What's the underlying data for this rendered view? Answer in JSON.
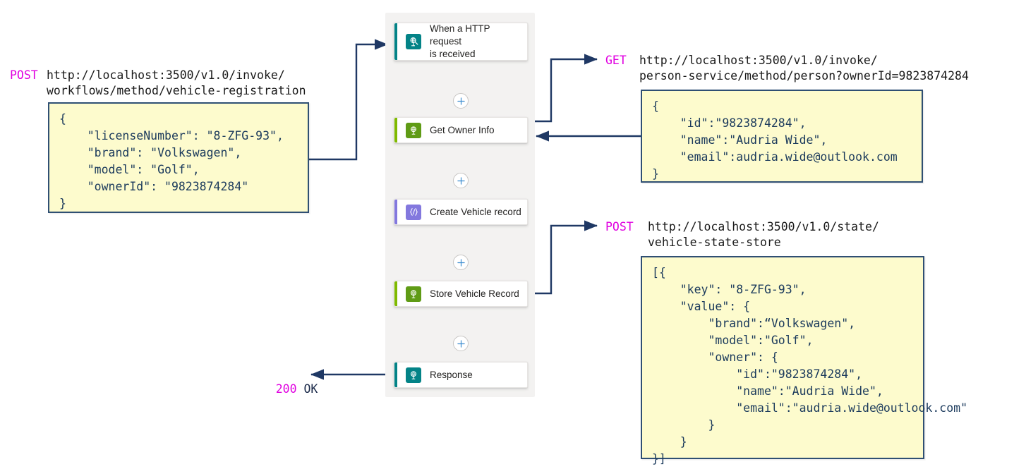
{
  "colors": {
    "trigger_accent": "#038387",
    "trigger_icon_bg": "#038387",
    "action_accent": "#7fba00",
    "action_icon_bg": "#5f9b15",
    "code_accent": "#8378de",
    "code_icon_bg": "#8378de",
    "wire": "#1f3864",
    "verb": "#e000e0",
    "json_fill": "#fdfbcd",
    "json_border": "#2f4f73",
    "container_bg": "#f3f2f1"
  },
  "workflow": {
    "nodes": [
      {
        "id": "http-trigger",
        "label": "When a HTTP request\nis received",
        "icon": "request-trigger-icon",
        "accent": "#038387",
        "icon_bg": "#038387",
        "type": "trigger"
      },
      {
        "id": "get-owner-info",
        "label": "Get Owner Info",
        "icon": "dapr-invoke-icon",
        "accent": "#7fba00",
        "icon_bg": "#5f9b15",
        "type": "action"
      },
      {
        "id": "create-vehicle-record",
        "label": "Create Vehicle record",
        "icon": "code-braces-icon",
        "accent": "#8378de",
        "icon_bg": "#8378de",
        "type": "code"
      },
      {
        "id": "store-vehicle-record",
        "label": "Store Vehicle Record",
        "icon": "dapr-state-icon",
        "accent": "#7fba00",
        "icon_bg": "#5f9b15",
        "type": "action"
      },
      {
        "id": "response",
        "label": "Response",
        "icon": "response-icon",
        "accent": "#038387",
        "icon_bg": "#038387",
        "type": "trigger"
      }
    ],
    "add_step_buttons": [
      {
        "id": "add-step-1",
        "label": "+"
      },
      {
        "id": "add-step-2",
        "label": "+"
      },
      {
        "id": "add-step-3",
        "label": "+"
      },
      {
        "id": "add-step-4",
        "label": "+"
      }
    ]
  },
  "request_in": {
    "verb": "POST",
    "url_line1": "http://localhost:3500/v1.0/invoke/",
    "url_line2": "workflows/method/vehicle-registration",
    "body": "{\n    \"licenseNumber\": \"8-ZFG-93\",\n    \"brand\": \"Volkswagen\",\n    \"model\": \"Golf\",\n    \"ownerId\": \"9823874284\"\n}"
  },
  "person_service_call": {
    "verb": "GET",
    "url_line1": "http://localhost:3500/v1.0/invoke/",
    "url_line2": "person-service/method/person?ownerId=9823874284",
    "body": "{\n    \"id\":\"9823874284\",\n    \"name\":\"Audria Wide\",\n    \"email\":audria.wide@outlook.com\n}"
  },
  "state_store_call": {
    "verb": "POST",
    "url_line1": "http://localhost:3500/v1.0/state/",
    "url_line2": "vehicle-state-store",
    "body": "[{\n    \"key\": \"8-ZFG-93\",\n    \"value\": {\n        \"brand\":“Volkswagen\",\n        \"model\":\"Golf\",\n        \"owner\": {\n            \"id\":\"9823874284\",\n            \"name\":\"Audria Wide\",\n            \"email\":\"audria.wide@outlook.com\"\n        }\n    }\n}]"
  },
  "response_out": {
    "code": "200",
    "text": "OK"
  }
}
